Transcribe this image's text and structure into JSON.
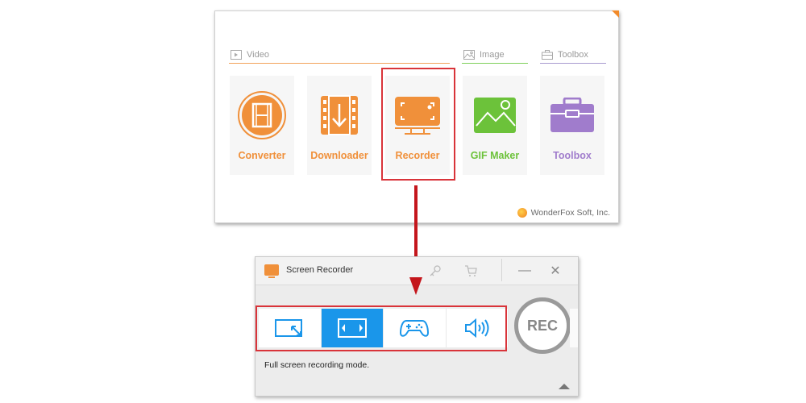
{
  "launcher": {
    "categories": {
      "video": "Video",
      "image": "Image",
      "toolbox": "Toolbox"
    },
    "tiles": [
      {
        "label": "Converter",
        "icon": "film-convert-icon",
        "color": "#f0903a"
      },
      {
        "label": "Downloader",
        "icon": "film-download-icon",
        "color": "#f0903a"
      },
      {
        "label": "Recorder",
        "icon": "monitor-record-icon",
        "color": "#f0903a"
      },
      {
        "label": "GIF Maker",
        "icon": "image-mountain-icon",
        "color": "#6cc23a"
      },
      {
        "label": "Toolbox",
        "icon": "toolbox-icon",
        "color": "#a07ccc"
      }
    ],
    "highlighted_tile": "Recorder",
    "brand": "WonderFox Soft, Inc."
  },
  "recorder_window": {
    "title": "Screen Recorder",
    "titlebar_buttons": [
      "key-icon",
      "cart-icon",
      "minimize",
      "close"
    ],
    "minimize_glyph": "—",
    "close_glyph": "✕",
    "modes": [
      {
        "name": "custom-region",
        "icon": "region-resize-icon",
        "active": false
      },
      {
        "name": "full-screen",
        "icon": "fullscreen-icon",
        "active": true
      },
      {
        "name": "game",
        "icon": "gamepad-icon",
        "active": false
      },
      {
        "name": "audio",
        "icon": "speaker-icon",
        "active": false
      }
    ],
    "rec_label": "REC",
    "status_text": "Full screen recording mode."
  },
  "colors": {
    "accent_blue": "#1a96ea",
    "highlight_red": "#d9343a",
    "arrow_red": "#c4161c",
    "orange": "#f0903a",
    "green": "#6cc23a",
    "purple": "#a07ccc"
  }
}
